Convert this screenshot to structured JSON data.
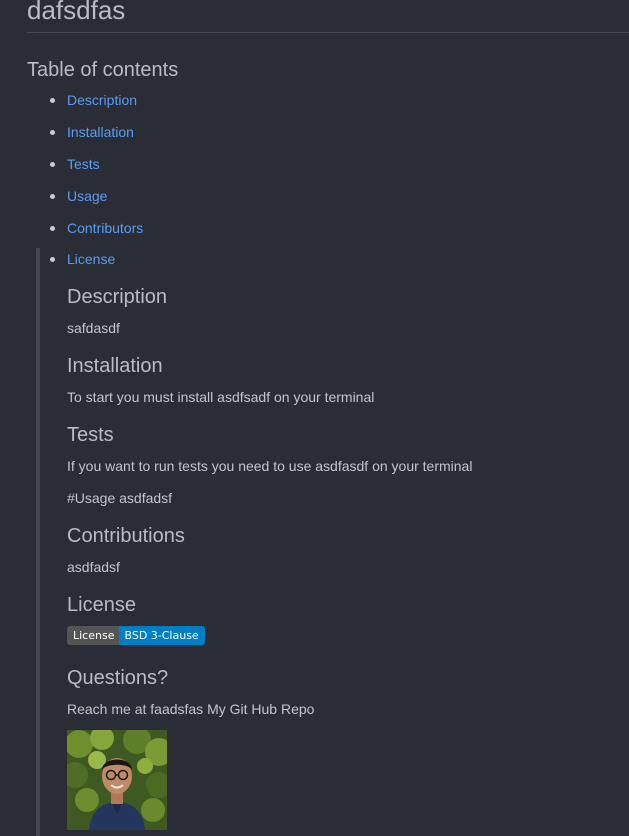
{
  "readme": {
    "title": "dafsdfas",
    "toc_heading": "Table of contents",
    "toc": [
      "Description",
      "Installation",
      "Tests",
      "Usage",
      "Contributors",
      "License"
    ],
    "sections": {
      "description": {
        "heading": "Description",
        "text": "safdasdf"
      },
      "installation": {
        "heading": "Installation",
        "text": "To start you must install asdfsadf on your terminal"
      },
      "tests": {
        "heading": "Tests",
        "text": "If you want to run tests you need to use asdfasdf on your terminal"
      },
      "usage_raw": "#Usage asdfadsf",
      "contributions": {
        "heading": "Contributions",
        "text": "asdfadsf"
      },
      "license": {
        "heading": "License",
        "badge_label": "License",
        "badge_value": "BSD 3-Clause"
      },
      "questions": {
        "heading": "Questions?",
        "text": "Reach me at faadsfas My Git Hub Repo"
      }
    }
  },
  "colors": {
    "background": "#2a2d35",
    "link": "#5b9cf2",
    "badge_label_bg": "#555555",
    "badge_value_bg": "#007ec6"
  },
  "icons": {
    "avatar": "profile-photo"
  }
}
